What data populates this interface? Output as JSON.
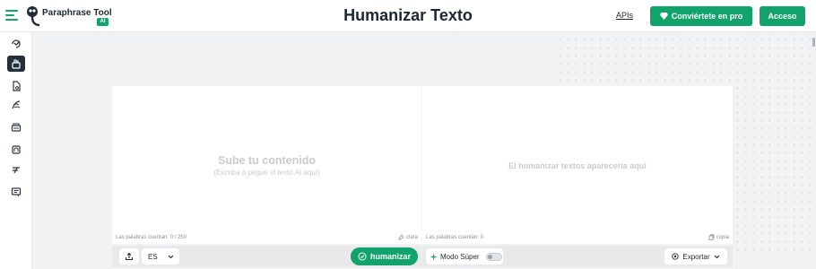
{
  "header": {
    "brand": "Paraphrase Tool",
    "brand_badge": "AI",
    "title": "Humanizar Texto",
    "apis_label": "APIs",
    "pro_label": "Conviértete en pro",
    "login_label": "Acceso"
  },
  "sidebar": {
    "items": [
      {
        "icon": "paraphrase-icon",
        "active": false
      },
      {
        "icon": "humanizer-icon",
        "active": true
      },
      {
        "icon": "document-icon",
        "active": false
      },
      {
        "icon": "text-tools-icon",
        "active": false
      },
      {
        "icon": "summarizer-icon",
        "active": false
      },
      {
        "icon": "grammar-icon",
        "active": false
      },
      {
        "icon": "translate-icon",
        "active": false
      },
      {
        "icon": "chat-icon",
        "active": false
      }
    ]
  },
  "input_panel": {
    "placeholder_main": "Sube tu contenido",
    "placeholder_sub": "(Escriba o pegue el texto AI aquí)",
    "word_count": "Las palabras cuentan: 0 / 250",
    "clear_label": "clara",
    "language": "ES",
    "humanize_label": "humanizar"
  },
  "output_panel": {
    "placeholder": "El humanizar textos aparecería aquí",
    "word_count": "Las palabras cuentan: 0",
    "copy_label": "copia",
    "mode_label": "Modo Súper",
    "mode_enabled": false,
    "export_label": "Exportar"
  },
  "colors": {
    "accent": "#11a36b",
    "sidebar_active": "#23303b"
  }
}
